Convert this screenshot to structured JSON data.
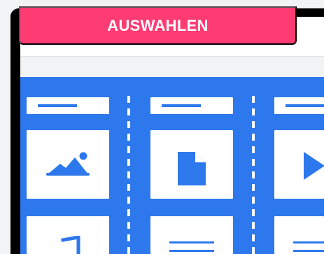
{
  "ui": {
    "select_button_label": "AUSWAHLEN"
  },
  "icons": {
    "image": "image-icon",
    "document": "document-icon",
    "video": "play-icon",
    "audio": "music-icon",
    "text": "text-lines-icon"
  },
  "colors": {
    "accent": "#FF3B74",
    "background": "#2D78EC"
  }
}
